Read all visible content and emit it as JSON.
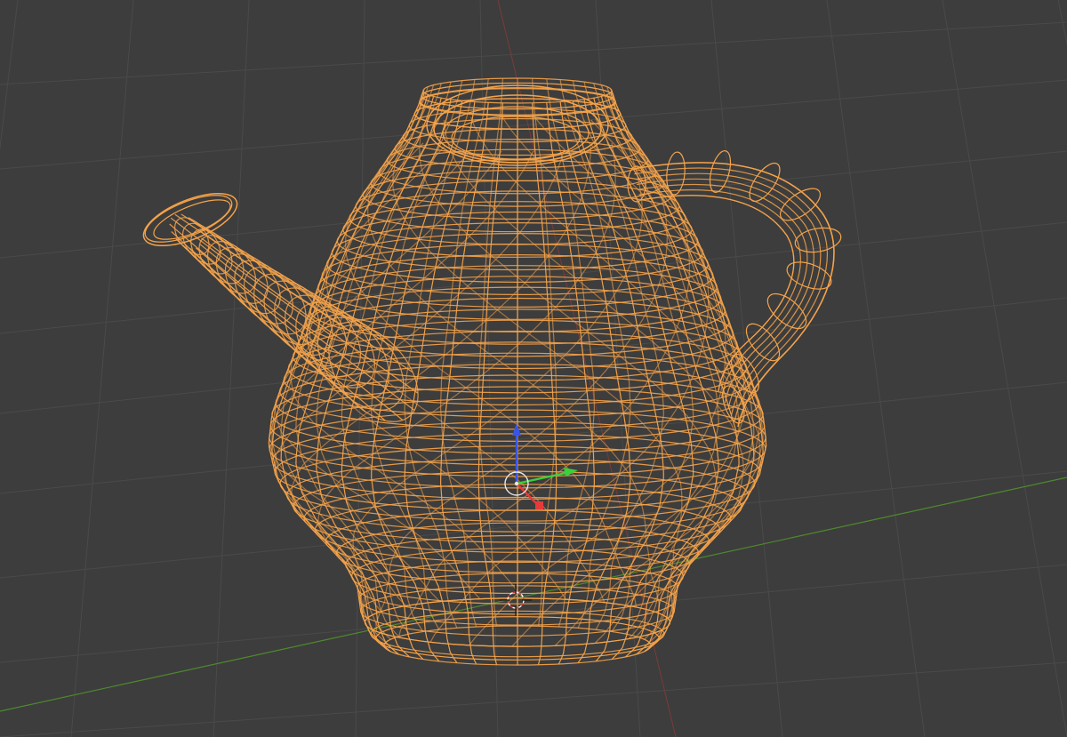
{
  "viewport": {
    "shading_mode": "wireframe",
    "object_icon": "teapot-mesh-icon",
    "colors": {
      "background": "#3d3d3d",
      "grid_line": "#4a4a4a",
      "grid_subline": "#444444",
      "x_axis_line": "#8a3a3a",
      "y_axis_line": "#4e8a2c",
      "wireframe": "#f5a34a",
      "gizmo_x": "#e53a3a",
      "gizmo_y": "#3ad13a",
      "gizmo_z": "#3a55e5",
      "origin": "#e8e8e8",
      "cursor_ring": "#ffffff"
    },
    "icons": [
      "3d-cursor-icon",
      "transform-gizmo-icon",
      "object-origin-icon"
    ]
  }
}
